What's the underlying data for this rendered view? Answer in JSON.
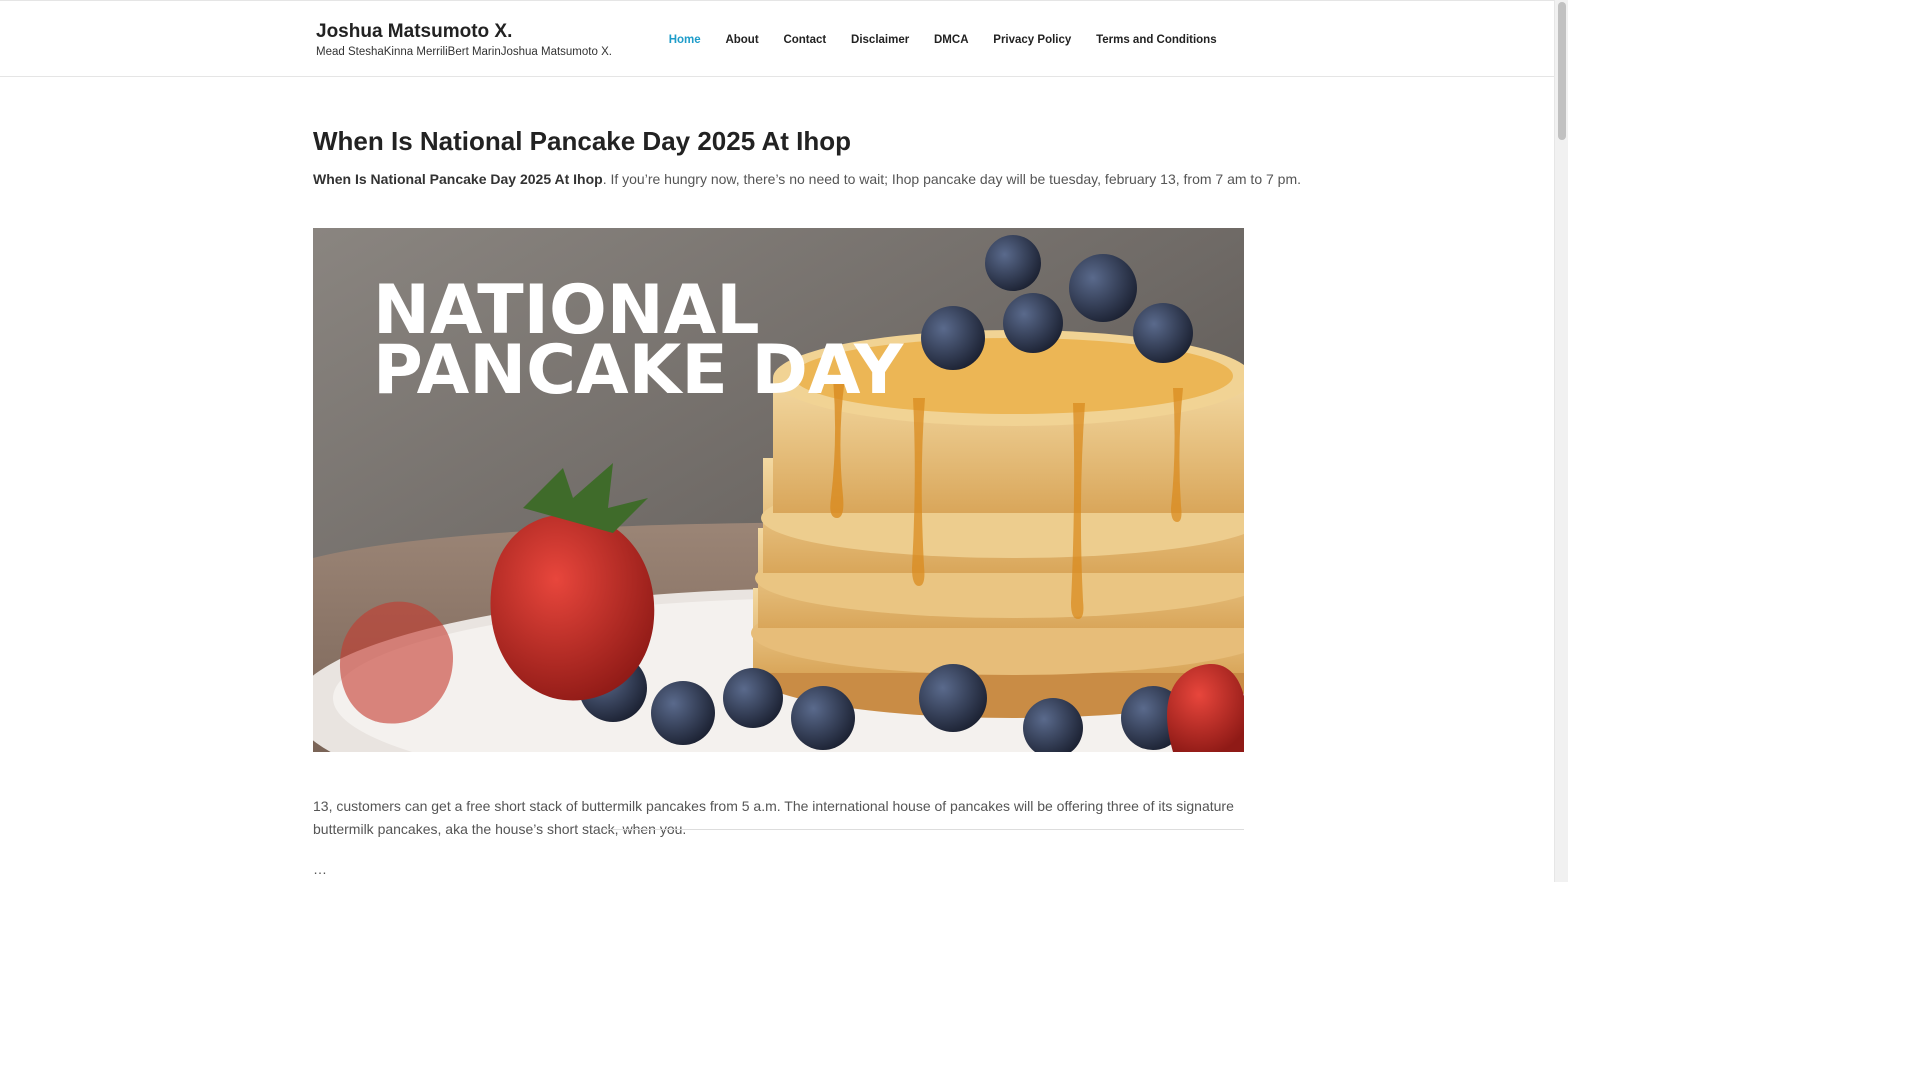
{
  "header": {
    "site_title": "Joshua Matsumoto X.",
    "tagline": "Mead SteshaKinna MerriliBert MarinJoshua Matsumoto X."
  },
  "nav": {
    "items": [
      {
        "label": "Home",
        "active": true
      },
      {
        "label": "About",
        "active": false
      },
      {
        "label": "Contact",
        "active": false
      },
      {
        "label": "Disclaimer",
        "active": false
      },
      {
        "label": "DMCA",
        "active": false
      },
      {
        "label": "Privacy Policy",
        "active": false
      },
      {
        "label": "Terms and Conditions",
        "active": false
      }
    ],
    "active_color": "#1e9cc9"
  },
  "post": {
    "title": "When Is National Pancake Day 2025 At Ihop",
    "intro_bold": "When Is National Pancake Day 2025 At Ihop",
    "intro_rest": ". If you’re hungry now, there’s no need to wait; Ihop pancake day will be tuesday, february 13, from 7 am to 7 pm.",
    "image": {
      "headline_line1": "NATIONAL",
      "headline_line2": "PANCAKE DAY"
    },
    "body_text": "13, customers can get a free short stack of buttermilk pancakes from 5 a.m. The international house of pancakes will be offering three of its signature buttermilk pancakes, aka the house’s short stack, when you.",
    "ellipsis": "…"
  }
}
